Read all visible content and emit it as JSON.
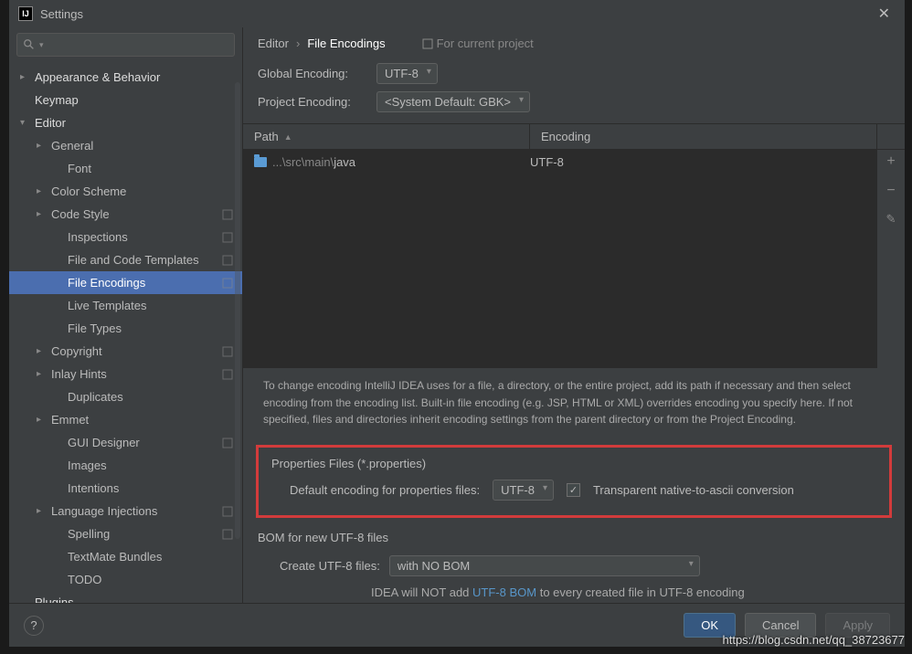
{
  "window": {
    "title": "Settings"
  },
  "search": {
    "placeholder": ""
  },
  "tree": {
    "items": [
      {
        "label": "Appearance & Behavior",
        "depth": 0,
        "arrow": "▸",
        "heading": true
      },
      {
        "label": "Keymap",
        "depth": 0,
        "arrow": "",
        "heading": true
      },
      {
        "label": "Editor",
        "depth": 0,
        "arrow": "▾",
        "heading": true
      },
      {
        "label": "General",
        "depth": 1,
        "arrow": "▸"
      },
      {
        "label": "Font",
        "depth": 2,
        "arrow": ""
      },
      {
        "label": "Color Scheme",
        "depth": 1,
        "arrow": "▸"
      },
      {
        "label": "Code Style",
        "depth": 1,
        "arrow": "▸",
        "badge": true
      },
      {
        "label": "Inspections",
        "depth": 2,
        "arrow": "",
        "badge": true
      },
      {
        "label": "File and Code Templates",
        "depth": 2,
        "arrow": "",
        "badge": true
      },
      {
        "label": "File Encodings",
        "depth": 2,
        "arrow": "",
        "badge": true,
        "selected": true
      },
      {
        "label": "Live Templates",
        "depth": 2,
        "arrow": ""
      },
      {
        "label": "File Types",
        "depth": 2,
        "arrow": ""
      },
      {
        "label": "Copyright",
        "depth": 1,
        "arrow": "▸",
        "badge": true
      },
      {
        "label": "Inlay Hints",
        "depth": 1,
        "arrow": "▸",
        "badge": true
      },
      {
        "label": "Duplicates",
        "depth": 2,
        "arrow": ""
      },
      {
        "label": "Emmet",
        "depth": 1,
        "arrow": "▸"
      },
      {
        "label": "GUI Designer",
        "depth": 2,
        "arrow": "",
        "badge": true
      },
      {
        "label": "Images",
        "depth": 2,
        "arrow": ""
      },
      {
        "label": "Intentions",
        "depth": 2,
        "arrow": ""
      },
      {
        "label": "Language Injections",
        "depth": 1,
        "arrow": "▸",
        "badge": true
      },
      {
        "label": "Spelling",
        "depth": 2,
        "arrow": "",
        "badge": true
      },
      {
        "label": "TextMate Bundles",
        "depth": 2,
        "arrow": ""
      },
      {
        "label": "TODO",
        "depth": 2,
        "arrow": ""
      },
      {
        "label": "Plugins",
        "depth": 0,
        "arrow": "",
        "heading": true
      }
    ]
  },
  "breadcrumb": {
    "root": "Editor",
    "current": "File Encodings",
    "project_hint": "For current project"
  },
  "global_encoding": {
    "label": "Global Encoding:",
    "value": "UTF-8"
  },
  "project_encoding": {
    "label": "Project Encoding:",
    "value": "<System Default: GBK>"
  },
  "table": {
    "columns": {
      "path": "Path",
      "encoding": "Encoding"
    },
    "rows": [
      {
        "path_prefix": "...\\src\\main\\",
        "path_name": "java",
        "encoding": "UTF-8"
      }
    ]
  },
  "help_text": "To change encoding IntelliJ IDEA uses for a file, a directory, or the entire project, add its path if necessary and then select encoding from the encoding list. Built-in file encoding (e.g. JSP, HTML or XML) overrides encoding you specify here. If not specified, files and directories inherit encoding settings from the parent directory or from the Project Encoding.",
  "properties": {
    "group_title": "Properties Files (*.properties)",
    "label": "Default encoding for properties files:",
    "value": "UTF-8",
    "checkbox_label": "Transparent native-to-ascii conversion",
    "checked": true
  },
  "bom": {
    "section_title": "BOM for new UTF-8 files",
    "label": "Create UTF-8 files:",
    "value": "with NO BOM",
    "note_prefix": "IDEA will NOT add ",
    "note_link": "UTF-8 BOM",
    "note_suffix": " to every created file in UTF-8 encoding"
  },
  "buttons": {
    "ok": "OK",
    "cancel": "Cancel",
    "apply": "Apply"
  },
  "watermark": "https://blog.csdn.net/qq_38723677"
}
